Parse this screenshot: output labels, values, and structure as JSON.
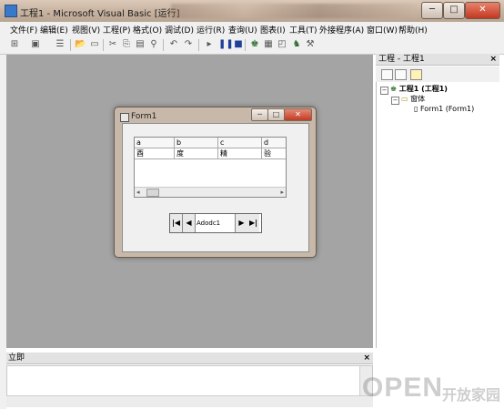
{
  "titlebar": {
    "title": "工程1 - Microsoft Visual Basic [运行]"
  },
  "menu": [
    "文件(F)",
    "编辑(E)",
    "视图(V)",
    "工程(P)",
    "格式(O)",
    "调试(D)",
    "运行(R)",
    "查询(U)",
    "图表(I)",
    "工具(T)",
    "外接程序(A)",
    "窗口(W)",
    "帮助(H)"
  ],
  "form1": {
    "title": "Form1",
    "grid": {
      "headers": [
        "a",
        "b",
        "c",
        "d"
      ],
      "row": [
        "酉",
        "度",
        "精",
        "验"
      ]
    },
    "adodc": {
      "caption": "Adodc1"
    }
  },
  "project": {
    "title": "工程 - 工程1",
    "close": "×",
    "tree": [
      {
        "label": "工程1 (工程1)"
      },
      {
        "label": "窗体"
      },
      {
        "label": "Form1 (Form1)"
      }
    ]
  },
  "immediate": {
    "title": "立即",
    "close": "×"
  },
  "watermark": {
    "big": "OPEN",
    "small": "开放家园"
  }
}
